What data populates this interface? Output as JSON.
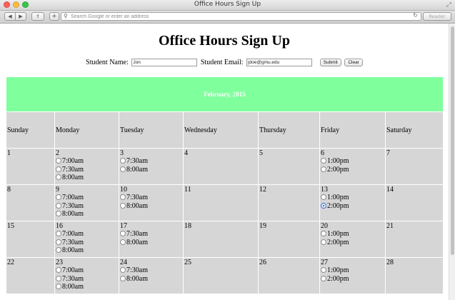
{
  "window": {
    "title": "Office Hours Sign Up",
    "back_glyph": "◀",
    "forward_glyph": "▶",
    "share_glyph": "⇪",
    "newtab_glyph": "+",
    "search_glyph": "⚲",
    "reload_glyph": "↻",
    "fullscreen_glyph": "⤢",
    "address_placeholder": "Search Google or enter an address",
    "reader_label": "Reader"
  },
  "page": {
    "title": "Office Hours Sign Up",
    "form": {
      "name_label": "Student Name:",
      "name_value": "Jon",
      "email_label": "Student Email:",
      "email_value": "jdoe@gmu.edu",
      "submit_label": "Submit",
      "clear_label": "Clear"
    }
  },
  "calendar": {
    "month_label": "February, 2015",
    "header_color": "#80ff9d",
    "days_of_week": [
      "Sunday",
      "Monday",
      "Tuesday",
      "Wednesday",
      "Thursday",
      "Friday",
      "Saturday"
    ],
    "weeks": [
      [
        {
          "day": "1",
          "slots": []
        },
        {
          "day": "2",
          "slots": [
            {
              "time": "7:00am",
              "checked": false
            },
            {
              "time": "7:30am",
              "checked": false
            },
            {
              "time": "8:00am",
              "checked": false
            }
          ]
        },
        {
          "day": "3",
          "slots": [
            {
              "time": "7:30am",
              "checked": false
            },
            {
              "time": "8:00am",
              "checked": false
            }
          ]
        },
        {
          "day": "4",
          "slots": []
        },
        {
          "day": "5",
          "slots": []
        },
        {
          "day": "6",
          "slots": [
            {
              "time": "1:00pm",
              "checked": false
            },
            {
              "time": "2:00pm",
              "checked": false
            }
          ]
        },
        {
          "day": "7",
          "slots": []
        }
      ],
      [
        {
          "day": "8",
          "slots": []
        },
        {
          "day": "9",
          "slots": [
            {
              "time": "7:00am",
              "checked": false
            },
            {
              "time": "7:30am",
              "checked": false
            },
            {
              "time": "8:00am",
              "checked": false
            }
          ]
        },
        {
          "day": "10",
          "slots": [
            {
              "time": "7:30am",
              "checked": false
            },
            {
              "time": "8:00am",
              "checked": false
            }
          ]
        },
        {
          "day": "11",
          "slots": []
        },
        {
          "day": "12",
          "slots": []
        },
        {
          "day": "13",
          "slots": [
            {
              "time": "1:00pm",
              "checked": false
            },
            {
              "time": "2:00pm",
              "checked": true
            }
          ]
        },
        {
          "day": "14",
          "slots": []
        }
      ],
      [
        {
          "day": "15",
          "slots": []
        },
        {
          "day": "16",
          "slots": [
            {
              "time": "7:00am",
              "checked": false
            },
            {
              "time": "7:30am",
              "checked": false
            },
            {
              "time": "8:00am",
              "checked": false
            }
          ]
        },
        {
          "day": "17",
          "slots": [
            {
              "time": "7:30am",
              "checked": false
            },
            {
              "time": "8:00am",
              "checked": false
            }
          ]
        },
        {
          "day": "18",
          "slots": []
        },
        {
          "day": "19",
          "slots": []
        },
        {
          "day": "20",
          "slots": [
            {
              "time": "1:00pm",
              "checked": false
            },
            {
              "time": "2:00pm",
              "checked": false
            }
          ]
        },
        {
          "day": "21",
          "slots": []
        }
      ],
      [
        {
          "day": "22",
          "slots": []
        },
        {
          "day": "23",
          "slots": [
            {
              "time": "7:00am",
              "checked": false
            },
            {
              "time": "7:30am",
              "checked": false
            },
            {
              "time": "8:00am",
              "checked": false
            }
          ]
        },
        {
          "day": "24",
          "slots": [
            {
              "time": "7:30am",
              "checked": false
            },
            {
              "time": "8:00am",
              "checked": false
            }
          ]
        },
        {
          "day": "25",
          "slots": []
        },
        {
          "day": "26",
          "slots": []
        },
        {
          "day": "27",
          "slots": [
            {
              "time": "1:00pm",
              "checked": false
            },
            {
              "time": "2:00pm",
              "checked": false
            }
          ]
        },
        {
          "day": "28",
          "slots": []
        }
      ]
    ]
  }
}
